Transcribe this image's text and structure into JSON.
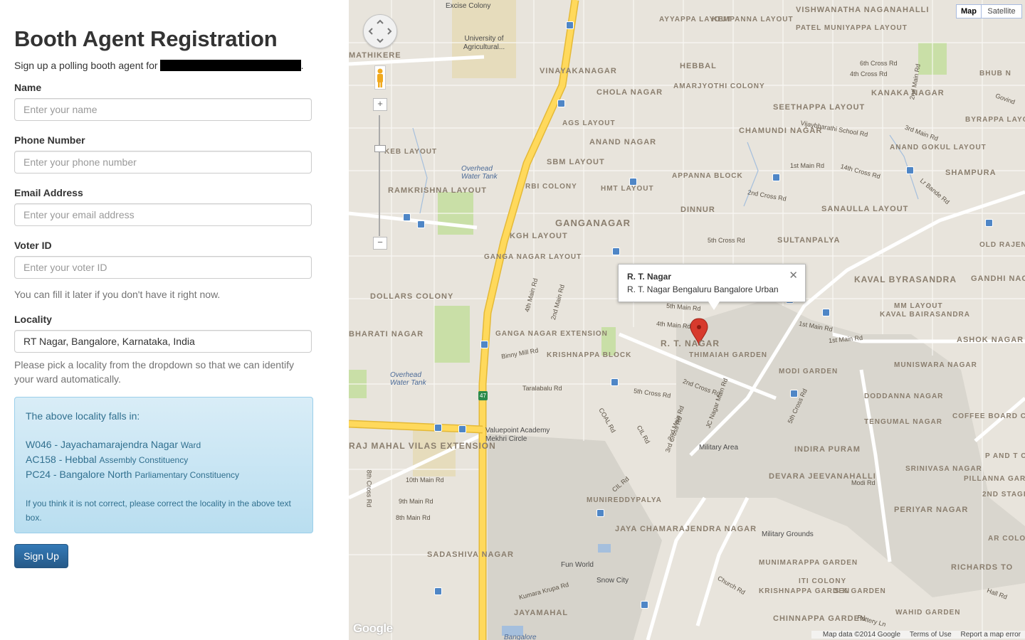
{
  "form": {
    "title": "Booth Agent Registration",
    "lead": "Sign up a polling booth agent for",
    "lead_end": ".",
    "name": {
      "label": "Name",
      "placeholder": "Enter your name",
      "value": ""
    },
    "phone": {
      "label": "Phone Number",
      "placeholder": "Enter your phone number",
      "value": ""
    },
    "email": {
      "label": "Email Address",
      "placeholder": "Enter your email address",
      "value": ""
    },
    "voter": {
      "label": "Voter ID",
      "placeholder": "Enter your voter ID",
      "value": "",
      "help": "You can fill it later if you don't have it right now."
    },
    "locality": {
      "label": "Locality",
      "value": "RT Nagar, Bangalore, Karnataka, India",
      "help": "Please pick a locality from the dropdown so that we can identify your ward automatically."
    },
    "info": {
      "heading": "The above locality falls in:",
      "ward": "W046 - Jayachamarajendra Nagar",
      "ward_suffix": "Ward",
      "assembly": "AC158 - Hebbal",
      "assembly_suffix": "Assembly Constituency",
      "parliament": "PC24 - Bangalore North",
      "parliament_suffix": "Parliamentary Constituency",
      "note": "If you think it is not correct, please correct the locality in the above text box."
    },
    "submit_label": "Sign Up"
  },
  "map": {
    "type_map": "Map",
    "type_satellite": "Satellite",
    "zoom_in": "+",
    "zoom_out": "−",
    "infowindow": {
      "title": "R. T. Nagar",
      "subtitle": "R. T. Nagar Bengaluru Bangalore Urban",
      "close": "✕"
    },
    "footer": {
      "data": "Map data ©2014 Google",
      "terms": "Terms of Use",
      "report": "Report a map error"
    },
    "logo": "Google",
    "highway_shield": "47",
    "areas": [
      "HEBBAL",
      "CHOLA NAGAR",
      "AMARJYOTHI COLONY",
      "VINAYAKANAGAR",
      "KANAKA NAGAR",
      "SEETHAPPA LAYOUT",
      "CHAMUNDI NAGAR",
      "ANAND NAGAR",
      "SBM LAYOUT",
      "APPANNA BLOCK",
      "DINNUR",
      "GANGANAGAR",
      "SULTANPALYA",
      "SANAULLA LAYOUT",
      "SHAMPURA",
      "RBI COLONY",
      "HMT LAYOUT",
      "KGH LAYOUT",
      "GANGA NAGAR LAYOUT",
      "RAMKRISHNA LAYOUT",
      "DOLLARS COLONY",
      "R. T. NAGAR",
      "THIMAIAH GARDEN",
      "KAVAL BYRASANDRA",
      "GANDHI NAGAR",
      "MM LAYOUT",
      "KAVAL BAIRASANDRA",
      "ASHOK NAGAR",
      "MUNISWARA NAGAR",
      "GANGA NAGAR EXTENSION",
      "KRISHNAPPA BLOCK",
      "MODI GARDEN",
      "DODDANNA NAGAR",
      "TENGUMAL NAGAR",
      "COFFEE BOARD COLONY",
      "INDIRA PURAM",
      "RAJ MAHAL VILAS EXTENSION",
      "DEVARA JEEVANAHALLI",
      "SRINIVASA NAGAR",
      "PILLANNA GARDEN",
      "MUNIREDDYPALYA",
      "JAYA CHAMARAJENDRA NAGAR",
      "PERIYAR NAGAR",
      "SADASHIVA NAGAR",
      "MUNIMARAPPA GARDEN",
      "ITI COLONY",
      "RICHARDS TO",
      "KRISHNAPPA GARDEN",
      "S K GARDEN",
      "JAYAMAHAL",
      "CHINNAPPA GARDEN",
      "WAHID GARDEN",
      "AYYAPPA LAYOUT",
      "KEMPANNA LAYOUT",
      "VISHWANATHA NAGANAHALLI",
      "PATEL MUNIYAPPA LAYOUT",
      "AGS LAYOUT",
      "BYRAPPA LAYOUT",
      "ANAND GOKUL LAYOUT",
      "OLD RAJENI NAGAR",
      "BHUB N",
      "MATHIKERE",
      "AR COLONY",
      "P AND T COLONY",
      "2ND STAGE",
      "KEB LAYOUT",
      "BHARATI NAGAR"
    ],
    "roads": [
      "6th Cross Rd",
      "4th Cross Rd",
      "2nd Main Rd",
      "Vijaybharathi School Rd",
      "3rd Main Rd",
      "1st Main Rd",
      "14th Cross Rd",
      "2nd Cross Rd",
      "5th Cross Rd",
      "Lr Bande Rd",
      "4th Main Rd",
      "2nd Main Rd",
      "5th Main Rd",
      "4th Main Rd",
      "Binny Mill Rd",
      "Taralabalu Rd",
      "5th Cross Rd",
      "2nd Cross Rd",
      "JC Nagar Main Rd",
      "1st Main Rd",
      "1st Main Rd",
      "5th Cross Rd",
      "COAL Rd",
      "CIL Rd",
      "3rd Cross Rd",
      "2nd Main Rd",
      "CIL Rd",
      "10th Main Rd",
      "9th Main Rd",
      "8th Main Rd",
      "8th Cross Rd",
      "Kumara Krupa Rd",
      "Church Rd",
      "Modi Rd",
      "Pottery Ln",
      "Hall Rd",
      "Govind"
    ],
    "pois": [
      "Excise Colony",
      "University of Agricultural...",
      "Military Area",
      "Military Grounds",
      "Fun World",
      "Snow City",
      "Valuepoint Academy",
      "Mekhri Circle",
      "Bangalore"
    ],
    "water": [
      "Overhead Water Tank",
      "Overhead Water Tank"
    ],
    "road_color": "#ffd95c",
    "pin_color": "#d73a2d"
  }
}
